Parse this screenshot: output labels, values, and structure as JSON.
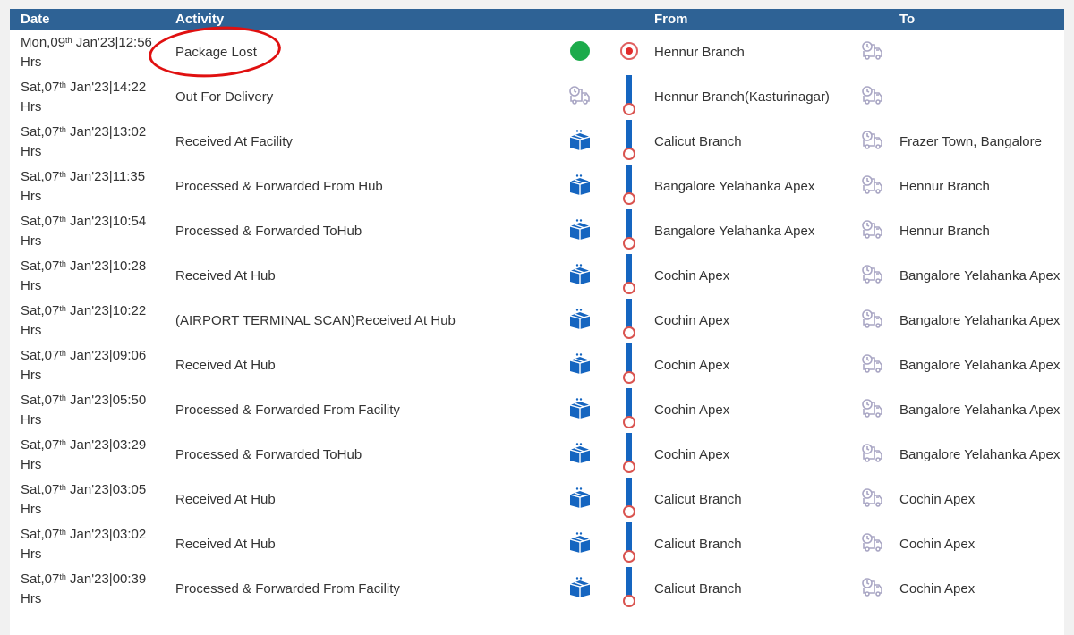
{
  "columns": {
    "date": "Date",
    "activity": "Activity",
    "from": "From",
    "to": "To"
  },
  "colors": {
    "header_bg": "#2e6295",
    "highlight": "#e01010",
    "status_current": "#1cab4b",
    "box_icon": "#1565c0",
    "truck_icon": "#a9a6c4"
  },
  "rows": [
    {
      "day": "Mon,09",
      "suffix": "th",
      "rest": " Jan'23|12:56",
      "hrs": "Hrs",
      "activity": "Package Lost",
      "status_icon": "green-dot",
      "track_icon": "target",
      "from": "Hennur Branch",
      "to": "",
      "highlighted": true
    },
    {
      "day": "Sat,07",
      "suffix": "th",
      "rest": " Jan'23|14:22",
      "hrs": "Hrs",
      "activity": "Out For Delivery",
      "status_icon": "truck",
      "track_icon": "thermometer",
      "from": "Hennur Branch(Kasturinagar)",
      "to": ""
    },
    {
      "day": "Sat,07",
      "suffix": "th",
      "rest": " Jan'23|13:02",
      "hrs": "Hrs",
      "activity": "Received At Facility",
      "status_icon": "box",
      "track_icon": "thermometer",
      "from": "Calicut Branch",
      "to": "Frazer Town, Bangalore"
    },
    {
      "day": "Sat,07",
      "suffix": "th",
      "rest": " Jan'23|11:35",
      "hrs": "Hrs",
      "activity": "Processed & Forwarded From Hub",
      "status_icon": "box",
      "track_icon": "thermometer",
      "from": "Bangalore Yelahanka Apex",
      "to": "Hennur Branch"
    },
    {
      "day": "Sat,07",
      "suffix": "th",
      "rest": " Jan'23|10:54",
      "hrs": "Hrs",
      "activity": "Processed & Forwarded ToHub",
      "status_icon": "box",
      "track_icon": "thermometer",
      "from": "Bangalore Yelahanka Apex",
      "to": "Hennur Branch"
    },
    {
      "day": "Sat,07",
      "suffix": "th",
      "rest": " Jan'23|10:28",
      "hrs": "Hrs",
      "activity": "Received At Hub",
      "status_icon": "box",
      "track_icon": "thermometer",
      "from": "Cochin Apex",
      "to": "Bangalore Yelahanka Apex"
    },
    {
      "day": "Sat,07",
      "suffix": "th",
      "rest": " Jan'23|10:22",
      "hrs": "Hrs",
      "activity": "(AIRPORT TERMINAL SCAN)Received At Hub",
      "status_icon": "box",
      "track_icon": "thermometer",
      "from": "Cochin Apex",
      "to": "Bangalore Yelahanka Apex"
    },
    {
      "day": "Sat,07",
      "suffix": "th",
      "rest": " Jan'23|09:06",
      "hrs": "Hrs",
      "activity": "Received At Hub",
      "status_icon": "box",
      "track_icon": "thermometer",
      "from": "Cochin Apex",
      "to": "Bangalore Yelahanka Apex"
    },
    {
      "day": "Sat,07",
      "suffix": "th",
      "rest": " Jan'23|05:50",
      "hrs": "Hrs",
      "activity": "Processed & Forwarded From Facility",
      "status_icon": "box",
      "track_icon": "thermometer",
      "from": "Cochin Apex",
      "to": "Bangalore Yelahanka Apex"
    },
    {
      "day": "Sat,07",
      "suffix": "th",
      "rest": " Jan'23|03:29",
      "hrs": "Hrs",
      "activity": "Processed & Forwarded ToHub",
      "status_icon": "box",
      "track_icon": "thermometer",
      "from": "Cochin Apex",
      "to": "Bangalore Yelahanka Apex"
    },
    {
      "day": "Sat,07",
      "suffix": "th",
      "rest": " Jan'23|03:05",
      "hrs": "Hrs",
      "activity": "Received At Hub",
      "status_icon": "box",
      "track_icon": "thermometer",
      "from": "Calicut Branch",
      "to": "Cochin Apex"
    },
    {
      "day": "Sat,07",
      "suffix": "th",
      "rest": " Jan'23|03:02",
      "hrs": "Hrs",
      "activity": "Received At Hub",
      "status_icon": "box",
      "track_icon": "thermometer",
      "from": "Calicut Branch",
      "to": "Cochin Apex"
    },
    {
      "day": "Sat,07",
      "suffix": "th",
      "rest": " Jan'23|00:39",
      "hrs": "Hrs",
      "activity": "Processed & Forwarded From Facility",
      "status_icon": "box",
      "track_icon": "thermometer",
      "from": "Calicut Branch",
      "to": "Cochin Apex"
    }
  ]
}
